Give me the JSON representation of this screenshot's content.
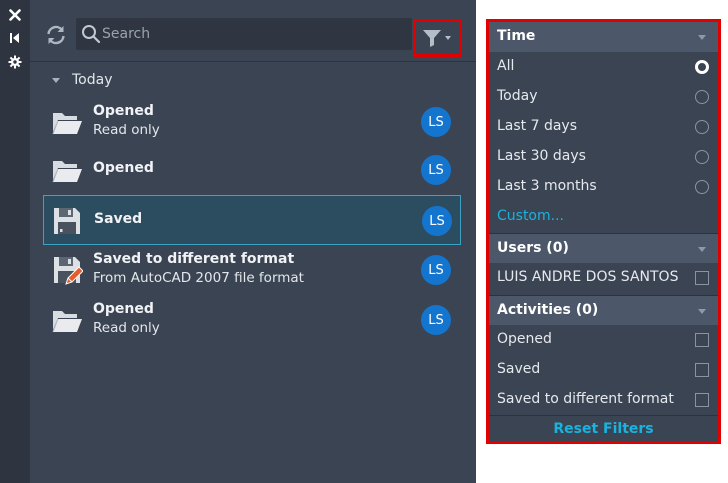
{
  "strip": {
    "close_icon": "close-icon",
    "collapse_icon": "collapse-icon",
    "settings_icon": "settings-icon"
  },
  "toolbar": {
    "refresh_icon": "refresh-icon",
    "search_placeholder": "Search",
    "filter_icon": "filter-icon"
  },
  "history": {
    "group_label": "Today",
    "items": [
      {
        "title": "Opened",
        "subtitle": "Read only",
        "icon": "folder-icon",
        "user": "LS",
        "selected": false
      },
      {
        "title": "Opened",
        "subtitle": "",
        "icon": "folder-icon",
        "user": "LS",
        "selected": false
      },
      {
        "title": "Saved",
        "subtitle": "",
        "icon": "floppy-icon",
        "user": "LS",
        "selected": true
      },
      {
        "title": "Saved to different format",
        "subtitle": "From AutoCAD 2007 file format",
        "icon": "floppy-edit-icon",
        "user": "LS",
        "selected": false
      },
      {
        "title": "Opened",
        "subtitle": "Read only",
        "icon": "folder-icon",
        "user": "LS",
        "selected": false
      }
    ]
  },
  "filters": {
    "time": {
      "label": "Time",
      "options": [
        "All",
        "Today",
        "Last 7 days",
        "Last 30 days",
        "Last 3 months"
      ],
      "selected": "All",
      "custom_label": "Custom..."
    },
    "users": {
      "label": "Users (0)",
      "options": [
        "LUIS ANDRE DOS SANTOS"
      ]
    },
    "activities": {
      "label": "Activities (0)",
      "options": [
        "Opened",
        "Saved",
        "Saved to different format"
      ]
    },
    "reset_label": "Reset Filters"
  },
  "colors": {
    "panel_bg": "#3b4453",
    "accent": "#19b3e0",
    "avatar": "#1475cf",
    "highlight_border": "#e00000"
  }
}
